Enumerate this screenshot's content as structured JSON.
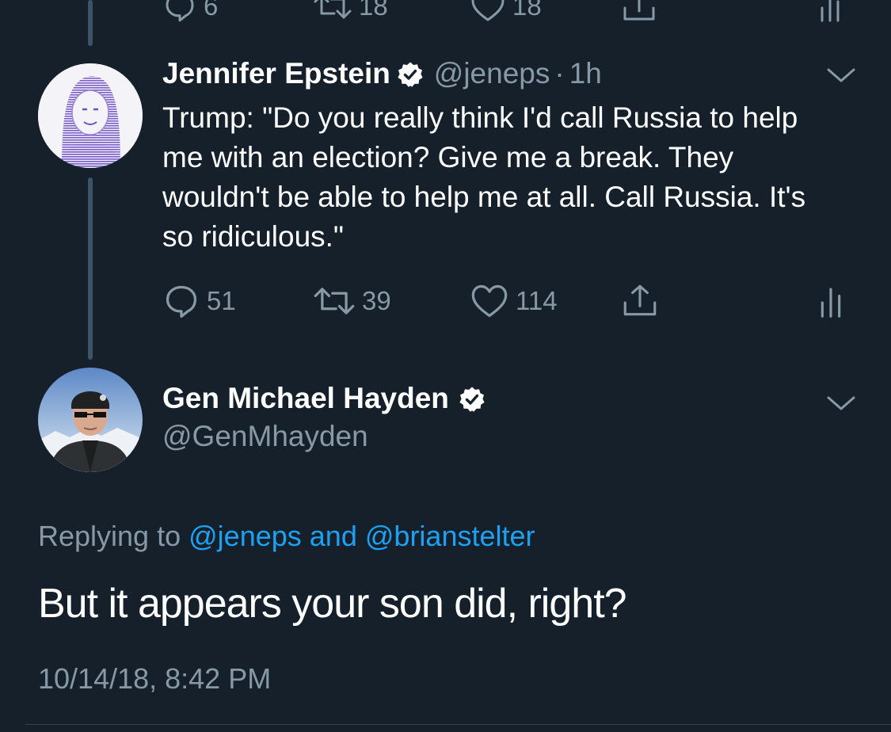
{
  "prev_tweet": {
    "reply_count": "6",
    "retweet_count": "18",
    "like_count": "18"
  },
  "tweet1": {
    "name": "Jennifer Epstein",
    "handle": "@jeneps",
    "separator": "·",
    "time": "1h",
    "text": "Trump: \"Do you really think I'd call Russia to help me with an election? Give me a break. They wouldn't be able to help me at all. Call Russia. It's so ridiculous.\"",
    "reply_count": "51",
    "retweet_count": "39",
    "like_count": "114"
  },
  "tweet2": {
    "name": "Gen Michael Hayden",
    "handle": "@GenMhayden",
    "replying_prefix": "Replying to",
    "reply_user1": "@jeneps",
    "reply_and": "and",
    "reply_user2": "@brianstelter",
    "text": "But it appears your son did, right?",
    "timestamp": "10/14/18, 8:42 PM"
  },
  "icons": [
    "reply-icon",
    "retweet-icon",
    "like-icon",
    "share-icon",
    "analytics-icon",
    "verified-badge-icon",
    "chevron-down-icon"
  ],
  "colors": {
    "background": "#15202b",
    "secondary_text": "#8899a6",
    "link": "#1da1f2",
    "thread_line": "#3d5466"
  }
}
